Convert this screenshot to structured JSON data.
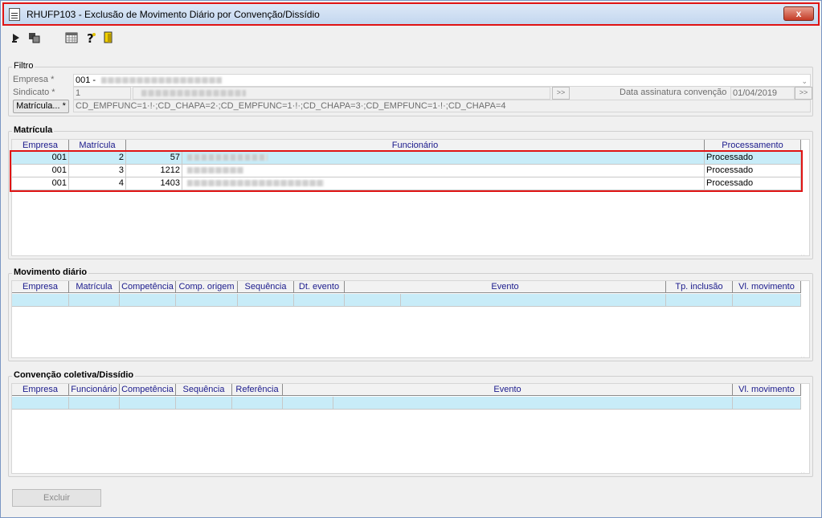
{
  "window": {
    "title": "RHUFP103 - Exclusão de Movimento Diário por Convenção/Dissídio",
    "close_label": "x"
  },
  "toolbar": {
    "icons": [
      "run-icon",
      "copy-icon",
      "calendar-icon",
      "help-icon",
      "exit-door-icon"
    ]
  },
  "filtro": {
    "group_label": "Filtro",
    "empresa_label": "Empresa *",
    "empresa_value": "001 -",
    "sindicato_label": "Sindicato *",
    "sindicato_value": "1",
    "data_label": "Data assinatura convenção",
    "data_value": "01/04/2019",
    "matricula_button": "Matrícula... *",
    "matricula_value": "CD_EMPFUNC=1·!·;CD_CHAPA=2·;CD_EMPFUNC=1·!·;CD_CHAPA=3·;CD_EMPFUNC=1·!·;CD_CHAPA=4"
  },
  "matricula": {
    "group_label": "Matrícula",
    "columns": [
      "Empresa",
      "Matrícula",
      "Funcionário",
      "Processamento"
    ],
    "rows": [
      {
        "empresa": "001",
        "matricula": "2",
        "funcionario_id": "57",
        "processamento": "Processado"
      },
      {
        "empresa": "001",
        "matricula": "3",
        "funcionario_id": "1212",
        "processamento": "Processado"
      },
      {
        "empresa": "001",
        "matricula": "4",
        "funcionario_id": "1403",
        "processamento": "Processado"
      }
    ]
  },
  "movimento": {
    "group_label": "Movimento diário",
    "columns": [
      "Empresa",
      "Matrícula",
      "Competência",
      "Comp. origem",
      "Sequência",
      "Dt. evento",
      "Evento",
      "Tp. inclusão",
      "Vl. movimento"
    ]
  },
  "convencao": {
    "group_label": "Convenção coletiva/Dissídio",
    "columns": [
      "Empresa",
      "Funcionário",
      "Competência",
      "Sequência",
      "Referência",
      "Evento",
      "Vl. movimento"
    ]
  },
  "actions": {
    "excluir_label": "Excluir"
  },
  "colors": {
    "highlight": "#e01414",
    "selected_row": "#c8ecf8",
    "header_text": "#1a1a8c"
  }
}
